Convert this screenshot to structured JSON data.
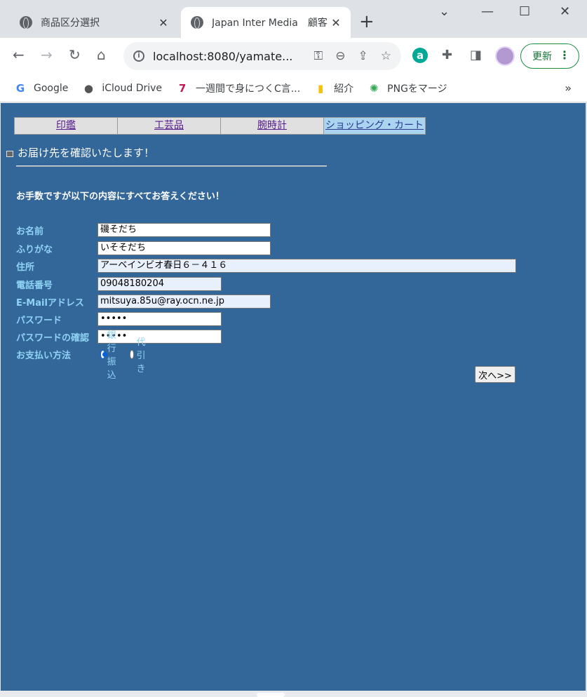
{
  "browser": {
    "tabs": [
      {
        "title": "商品区分選択",
        "close": "✕"
      },
      {
        "title": "Japan Inter Media　顧客",
        "close": "✕"
      }
    ],
    "new_tab": "+",
    "window": {
      "minimize": "—",
      "maximize": "☐",
      "close": "✕",
      "list": "⌄"
    },
    "nav": {
      "back": "←",
      "forward": "→",
      "reload": "↻",
      "home": "⌂"
    },
    "url": "localhost:8080/yamate...",
    "update_label": "更新",
    "bookmarks": [
      "Google",
      "iCloud Drive",
      "一週間で身につくC言...",
      "紹介",
      "PNGをマージ"
    ],
    "bookmarks_more": "»"
  },
  "page": {
    "menu": [
      "印鑑",
      "工芸品",
      "腕時計",
      "ショッピング・カート"
    ],
    "heading": "お届け先を確認いたします！",
    "notice": "お手数ですが以下の内容にすべてお答えください！",
    "fields": {
      "name": {
        "label": "お名前",
        "value": "磯そだち"
      },
      "furigana": {
        "label": "ふりがな",
        "value": "いそそだち"
      },
      "address": {
        "label": "住所",
        "value": "アーベインビオ春日６－４１６"
      },
      "phone": {
        "label": "電話番号",
        "value": "09048180204"
      },
      "email": {
        "label": "E-Mailアドレス",
        "value": "mitsuya.85u@ray.ocn.ne.jp"
      },
      "password": {
        "label": "パスワード",
        "value": "•••••"
      },
      "password_confirm": {
        "label": "パスワードの確認",
        "value": "•••••"
      },
      "payment": {
        "label": "お支払い方法",
        "options": [
          "銀行振込",
          "代引き"
        ],
        "selected": "銀行振込"
      }
    },
    "next_button": "次へ>>"
  },
  "colors": {
    "page_bg": "#336699",
    "label": "#8fd3f5",
    "cart_tab": "#aad4f0"
  }
}
